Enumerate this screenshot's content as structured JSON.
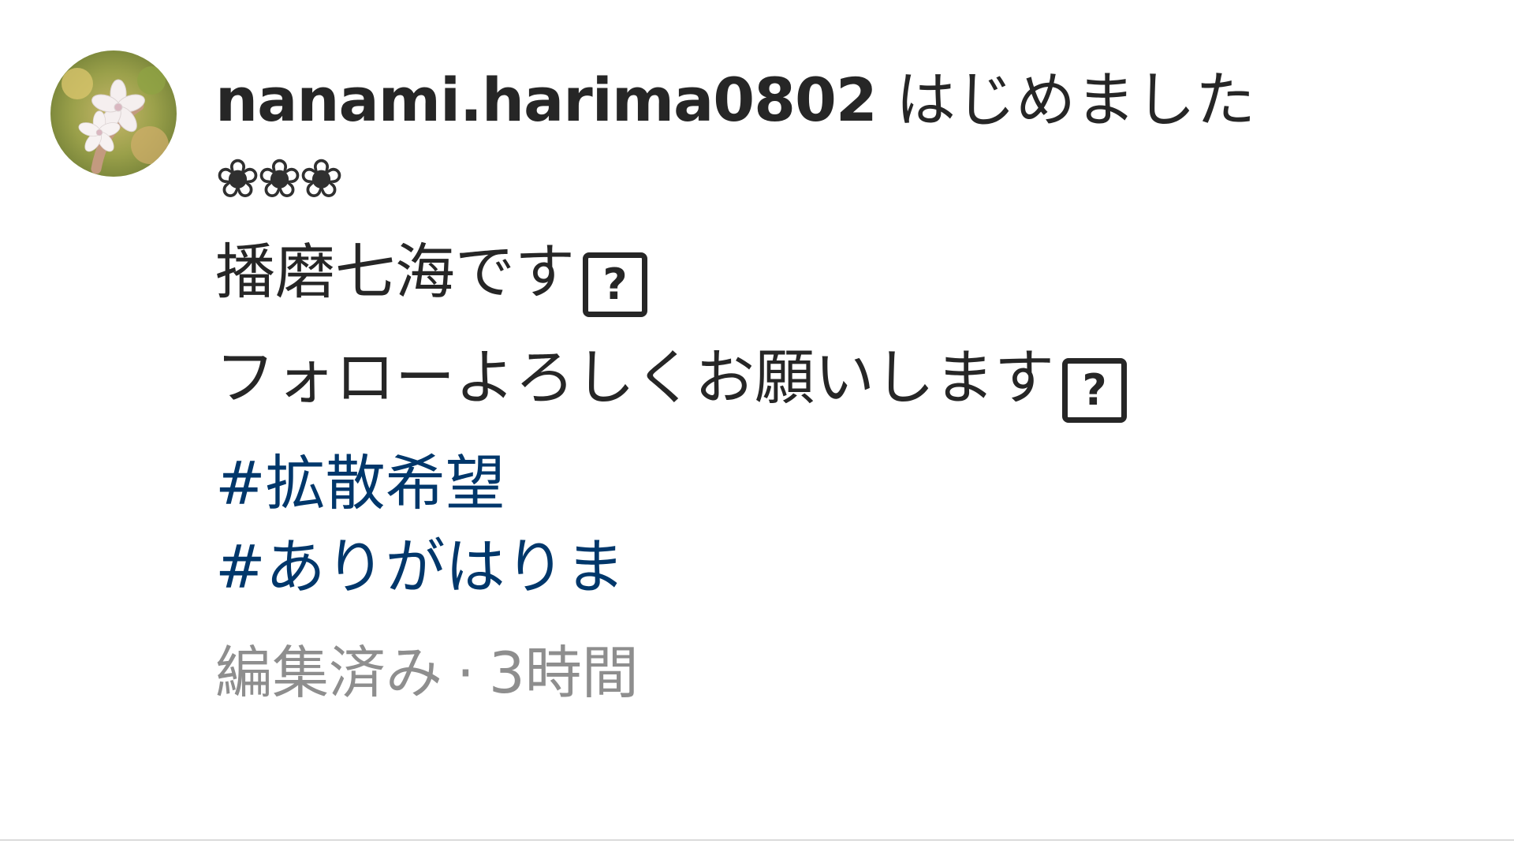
{
  "comment": {
    "username": "nanami.harima0802",
    "caption_first": "はじめました",
    "flowers": "❀❀❀",
    "line_1": "播磨七海です",
    "line_2": "フォローよろしくお願いします",
    "missing_glyph": "?",
    "hashtags": [
      "#拡散希望",
      " #ありがはりま"
    ],
    "edited_label": "編集済み",
    "separator": "·",
    "time_ago": "3時間"
  },
  "avatar": {
    "icon": "cherry-blossom-photo-avatar"
  },
  "colors": {
    "text": "#262626",
    "hashtag": "#00376b",
    "meta": "#8e8e8e",
    "divider": "#dbdbdb"
  }
}
